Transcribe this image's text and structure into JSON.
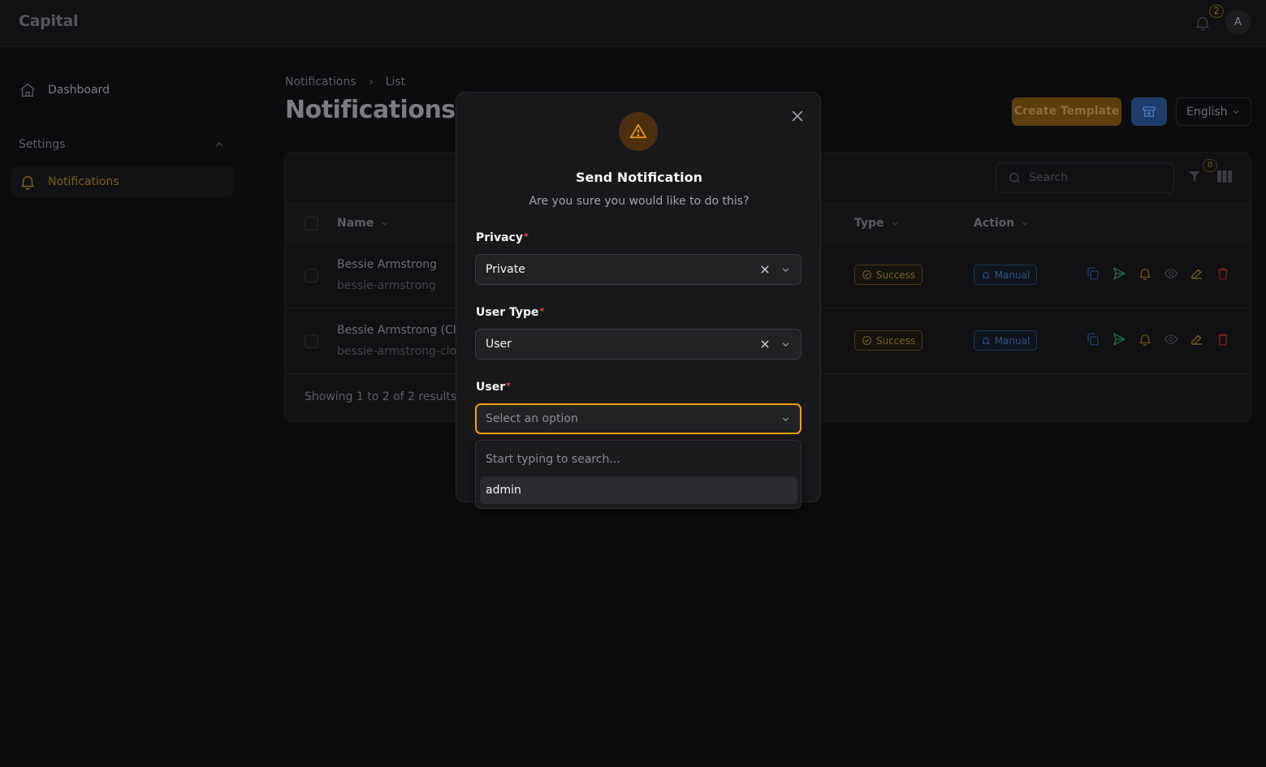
{
  "app": {
    "brand": "Capital",
    "notification_count": "2",
    "avatar_initial": "A"
  },
  "sidebar": {
    "dashboard_label": "Dashboard",
    "settings_label": "Settings",
    "notifications_label": "Notifications"
  },
  "breadcrumb": {
    "items": [
      "Notifications",
      "List"
    ]
  },
  "page": {
    "title": "Notifications"
  },
  "header_actions": {
    "create_template_label": "Create Template",
    "language": "English"
  },
  "table": {
    "search_placeholder": "Search",
    "filter_count": "0",
    "columns": {
      "name": "Name",
      "type": "Type",
      "action": "Action"
    },
    "rows": [
      {
        "name": "Bessie Armstrong",
        "slug": "bessie-armstrong",
        "type": "Success",
        "action": "Manual"
      },
      {
        "name": "Bessie Armstrong (Clo",
        "slug": "bessie-armstrong-clo",
        "type": "Success",
        "action": "Manual"
      }
    ],
    "results_text": "Showing 1 to 2 of 2 results"
  },
  "modal": {
    "title": "Send Notification",
    "subtitle": "Are you sure you would like to do this?",
    "required_marker": "*",
    "fields": {
      "privacy": {
        "label": "Privacy",
        "value": "Private"
      },
      "user_type": {
        "label": "User Type",
        "value": "User"
      },
      "user": {
        "label": "User",
        "placeholder": "Select an option"
      }
    },
    "dropdown": {
      "search_placeholder": "Start typing to search...",
      "options": [
        "admin"
      ]
    }
  },
  "colors": {
    "accent": "#f59e0b",
    "primary_blue": "#1f3c6b",
    "danger": "#ef4444"
  }
}
